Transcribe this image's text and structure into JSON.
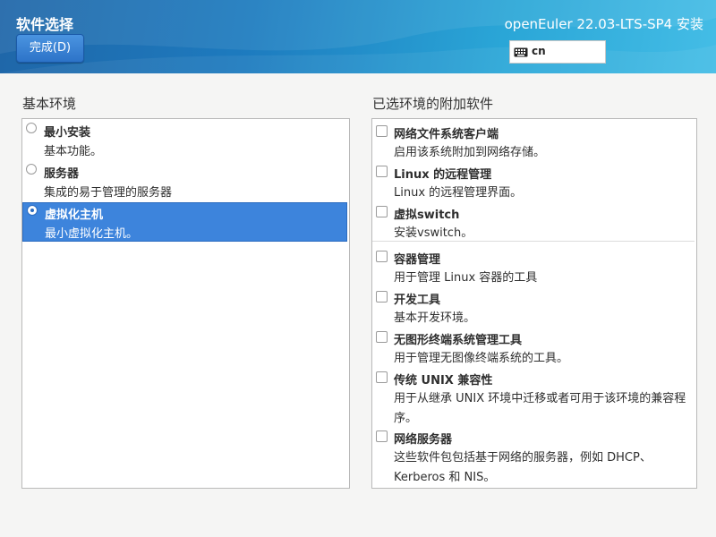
{
  "header": {
    "title": "软件选择",
    "done_label": "完成(D)",
    "product": "openEuler 22.03-LTS-SP4 安装",
    "keyboard_layout": "cn"
  },
  "base_environment": {
    "label": "基本环境",
    "items": [
      {
        "title": "最小安装",
        "desc": "基本功能。",
        "selected": false
      },
      {
        "title": "服务器",
        "desc": "集成的易于管理的服务器",
        "selected": false
      },
      {
        "title": "虚拟化主机",
        "desc": "最小虚拟化主机。",
        "selected": true
      }
    ]
  },
  "addons": {
    "label": "已选环境的附加软件",
    "items": [
      {
        "title": "网络文件系统客户端",
        "desc": "启用该系统附加到网络存储。",
        "checked": false
      },
      {
        "title": "Linux 的远程管理",
        "desc": "Linux 的远程管理界面。",
        "checked": false
      },
      {
        "title": "虚拟switch",
        "desc": "安装vswitch。",
        "checked": false
      },
      {
        "title": "容器管理",
        "desc": "用于管理 Linux 容器的工具",
        "checked": false
      },
      {
        "title": "开发工具",
        "desc": "基本开发环境。",
        "checked": false
      },
      {
        "title": "无图形终端系统管理工具",
        "desc": "用于管理无图像终端系统的工具。",
        "checked": false
      },
      {
        "title": "传统 UNIX 兼容性",
        "desc": "用于从继承 UNIX 环境中迁移或者可用于该环境的兼容程序。",
        "checked": false
      },
      {
        "title": "网络服务器",
        "desc": "这些软件包包括基于网络的服务器，例如 DHCP、Kerberos 和 NIS。",
        "checked": false
      }
    ]
  },
  "colors": {
    "selected_bg": "#3d84dc",
    "header_start": "#1f66a8",
    "header_end": "#44bde6"
  }
}
